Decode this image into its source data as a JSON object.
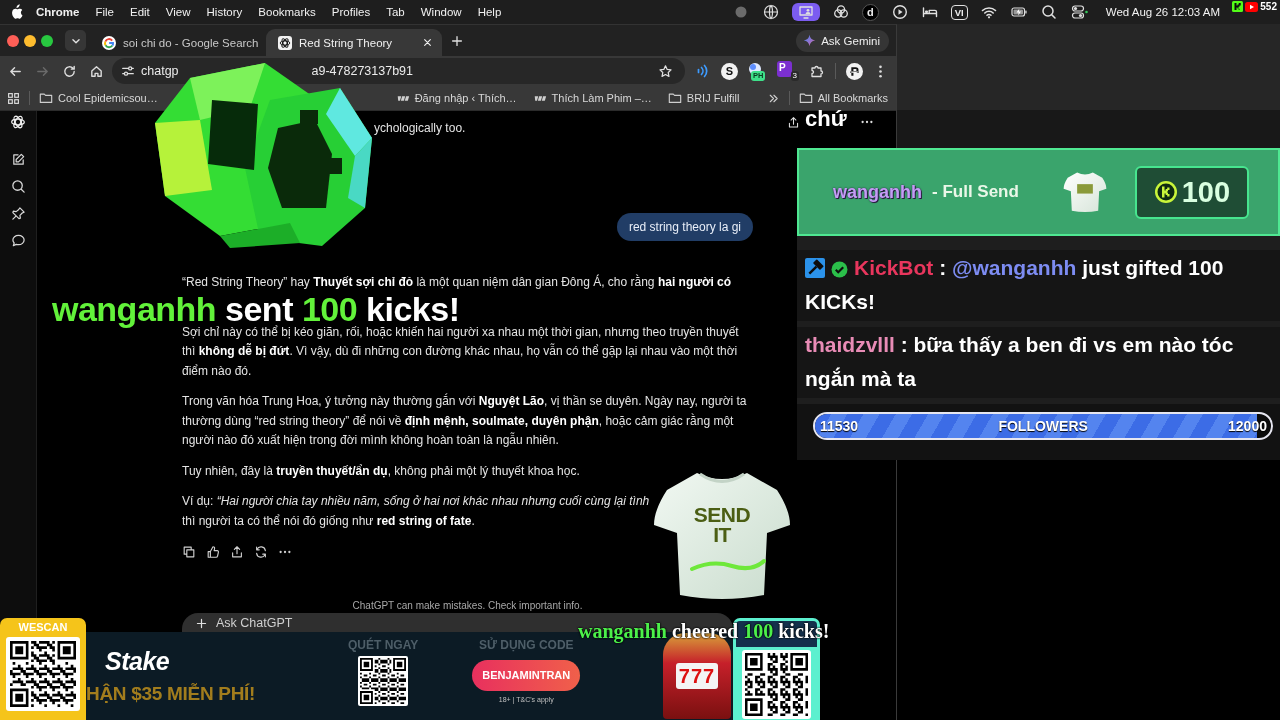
{
  "menu_bar": {
    "app": "Chrome",
    "menus": [
      "File",
      "Edit",
      "View",
      "History",
      "Bookmarks",
      "Profiles",
      "Tab",
      "Window",
      "Help"
    ],
    "status_items": [
      {
        "kind": "dot",
        "active": false
      },
      {
        "kind": "globe",
        "active": false
      },
      {
        "kind": "screen",
        "active": true
      },
      {
        "kind": "rings",
        "active": false
      },
      {
        "kind": "letter",
        "text": "d",
        "active": false
      },
      {
        "kind": "play",
        "active": false
      },
      {
        "kind": "bed",
        "active": false
      },
      {
        "kind": "input",
        "text": "VI",
        "active": false
      },
      {
        "kind": "wifi",
        "active": false
      },
      {
        "kind": "battery",
        "active": false
      },
      {
        "kind": "search",
        "active": false
      },
      {
        "kind": "controls",
        "active": false
      }
    ],
    "clock": "Wed Aug 26 12:03 AM"
  },
  "viewer_count": {
    "count": "552"
  },
  "browser": {
    "tabs": [
      {
        "title": "soi chi do - Google Search",
        "selected": false
      },
      {
        "title": "Red String Theory",
        "selected": true
      }
    ],
    "ask_gemini": "Ask Gemini",
    "forward_disabled": true,
    "url_parts": [
      "chatgp",
      "a9-478273137b91"
    ],
    "extensions": [
      {
        "kind": "waves"
      },
      {
        "kind": "letter",
        "text": "S"
      },
      {
        "kind": "badge",
        "text": "PH"
      },
      {
        "kind": "count",
        "text": "P",
        "count": "3"
      },
      {
        "kind": "puzzle"
      }
    ],
    "bookmarks": [
      {
        "kind": "folder",
        "title": "Cool Epidemicsou…"
      },
      {
        "kind": "site",
        "title": "Đăng nhập ‹ Thích…"
      },
      {
        "kind": "site",
        "title": "Thích Làm Phim –…"
      },
      {
        "kind": "folder",
        "title": "BRIJ Fulfill"
      }
    ],
    "all_bookmarks": "All Bookmarks"
  },
  "chat": {
    "previous_tail": "ychologically too.",
    "user_message": "red string theory la gi",
    "paragraphs": [
      "“Red String Theory” hay **Thuyết sợi chỉ đỏ** là một quan niệm dân gian Đông Á, cho rằng **hai người có**",
      "Sợi chỉ này có thể bị kéo giãn, rối, hoặc khiến hai người xa nhau một thời gian, nhưng theo truyền thuyết thì **không dễ bị đứt**. Vì vậy, dù đi những con đường khác nhau, họ vẫn có thể gặp lại nhau vào một thời điểm nào đó.",
      "Trong văn hóa Trung Hoa, ý tưởng này thường gắn với **Nguyệt Lão**, vị thần se duyên. Ngày nay, người ta thường dùng “red string theory” để nói về **định mệnh, soulmate, duyên phận**, hoặc cảm giác rằng một người nào đó xuất hiện trong đời mình không hoàn toàn là ngẫu nhiên.",
      "Tuy nhiên, đây là **truyền thuyết/ẩn dụ**, không phải một lý thuyết khoa học.",
      "Ví dụ: *“Hai người chia tay nhiều năm, sống ở hai nơi khác nhau nhưng cuối cùng lại tình*\nthì người ta có thể nói đó giống như **red string of fate**."
    ],
    "disclaimer": "ChatGPT can make mistakes. Check important info.",
    "composer": {
      "placeholder": "Ask ChatGPT"
    }
  },
  "overlays": {
    "gift_text": "**wanganhh** sent **100** kicks!",
    "shirt_print": "SEND IT",
    "cheer_text": "**wanganhh** cheered **100** kicks!"
  },
  "stream_panel": {
    "cut_message": "chứ",
    "gift_alert": {
      "user": "wanganhh",
      "item": "- Full Send",
      "amount": "100"
    },
    "messages": [
      {
        "kind": "moderator",
        "user": "KickBot",
        "color": "#e8365d",
        "separator": ":",
        "mention": "@wanganhh",
        "text": "just gifted 100 KICKs!"
      },
      {
        "kind": "viewer",
        "user": "thaidzvlll",
        "color": "#e98cb6",
        "separator": ":",
        "text": "bữa thấy a ben đi vs em nào tóc ngắn mà ta"
      }
    ],
    "follower_goal": {
      "current": "11530",
      "label": "FOLLOWERS",
      "goal": "12000",
      "level": 0.97
    }
  },
  "ad_bar": {
    "qr_label": "WESCAN",
    "brand": "Stake",
    "offer": "HẬN $35 MIỄN PHÍ!",
    "scan_label": "QUÉT NGAY",
    "code_label": "SỬ DỤNG CODE",
    "code": "BENJAMINTRAN",
    "terms": "18+ | T&C's apply",
    "reels": "777"
  }
}
